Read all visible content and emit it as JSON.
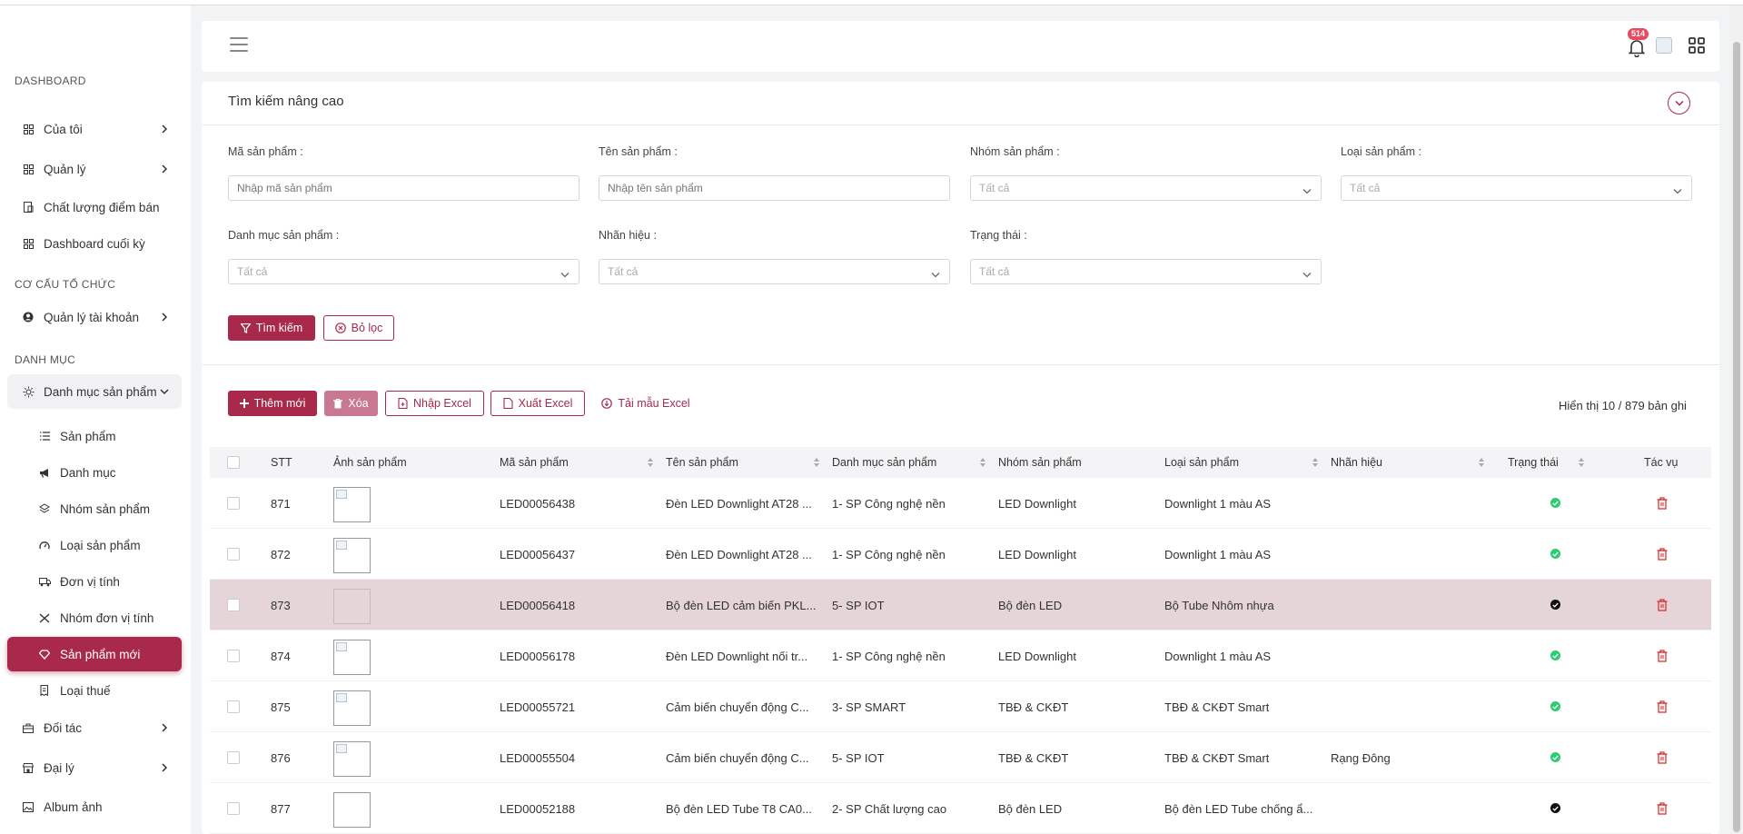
{
  "sidebar": {
    "sections": [
      "DASHBOARD",
      "CƠ CẤU TỔ CHỨC",
      "DANH MỤC"
    ],
    "items": [
      {
        "label": "Của tôi",
        "icon": "dashboard-grid-icon"
      },
      {
        "label": "Quản lý",
        "icon": "dashboard-grid-icon"
      },
      {
        "label": "Chất lượng điểm bán",
        "icon": "store-icon"
      },
      {
        "label": "Dashboard cuối kỳ",
        "icon": "dashboard-grid-icon"
      },
      {
        "label": "Quản lý tài khoản",
        "icon": "user-circle-icon"
      },
      {
        "label": "Danh mục sản phẩm",
        "icon": "sun-icon"
      },
      {
        "label": "Sản phẩm",
        "icon": "list-icon"
      },
      {
        "label": "Danh mục",
        "icon": "megaphone-icon"
      },
      {
        "label": "Nhóm sản phẩm",
        "icon": "layers-icon"
      },
      {
        "label": "Loại sản phẩm",
        "icon": "gauge-icon"
      },
      {
        "label": "Đơn vị tính",
        "icon": "truck-icon"
      },
      {
        "label": "Nhóm đơn vị tính",
        "icon": "shuffle-icon"
      },
      {
        "label": "Sản phẩm mới",
        "icon": "diamond-icon"
      },
      {
        "label": "Loại thuế",
        "icon": "receipt-icon"
      },
      {
        "label": "Đối tác",
        "icon": "briefcase-icon"
      },
      {
        "label": "Đại lý",
        "icon": "shop-icon"
      },
      {
        "label": "Album ảnh",
        "icon": "image-icon"
      }
    ]
  },
  "header": {
    "notification_count": "514"
  },
  "search": {
    "title": "Tìm kiếm nâng cao",
    "fields": {
      "product_code": {
        "label": "Mã sản phẩm :",
        "placeholder": "Nhập mã sản phẩm"
      },
      "product_name": {
        "label": "Tên sản phẩm :",
        "placeholder": "Nhập tên sản phẩm"
      },
      "product_group": {
        "label": "Nhóm sản phẩm :",
        "value": "Tất cả"
      },
      "product_type": {
        "label": "Loại sản phẩm :",
        "value": "Tất cả"
      },
      "product_category": {
        "label": "Danh mục sản phẩm :",
        "value": "Tất cả"
      },
      "brand": {
        "label": "Nhãn hiệu :",
        "value": "Tất cả"
      },
      "status": {
        "label": "Trạng thái :",
        "value": "Tất cả"
      }
    },
    "search_button": "Tìm kiếm",
    "reset_button": "Bỏ lọc"
  },
  "toolbar": {
    "add": "Thêm mới",
    "delete": "Xóa",
    "import": "Nhập Excel",
    "export": "Xuất Excel",
    "template": "Tải mẫu Excel",
    "record_info": "Hiển thị 10 / 879 bản ghi"
  },
  "table": {
    "columns": [
      "STT",
      "Ảnh sản phẩm",
      "Mã sản phẩm",
      "Tên sản phẩm",
      "Danh mục sản phẩm",
      "Nhóm sản phẩm",
      "Loại sản phẩm",
      "Nhãn hiệu",
      "Trạng thái",
      "Tác vụ"
    ],
    "rows": [
      {
        "stt": "871",
        "code": "LED00056438",
        "name": "Đèn LED Downlight AT28 ...",
        "category": "1- SP Công nghệ nền",
        "group": "LED Downlight",
        "type": "Downlight 1 màu AS",
        "brand": "",
        "status": "active"
      },
      {
        "stt": "872",
        "code": "LED00056437",
        "name": "Đèn LED Downlight AT28 ...",
        "category": "1- SP Công nghệ nền",
        "group": "LED Downlight",
        "type": "Downlight 1 màu AS",
        "brand": "",
        "status": "active"
      },
      {
        "stt": "873",
        "code": "LED00056418",
        "name": "Bộ đèn LED cảm biến PKL...",
        "category": "5- SP IOT",
        "group": "Bộ đèn LED",
        "type": "Bộ Tube Nhôm nhựa",
        "brand": "",
        "status": "dark"
      },
      {
        "stt": "874",
        "code": "LED00056178",
        "name": "Đèn LED Downlight nối tr...",
        "category": "1- SP Công nghệ nền",
        "group": "LED Downlight",
        "type": "Downlight 1 màu AS",
        "brand": "",
        "status": "active"
      },
      {
        "stt": "875",
        "code": "LED00055721",
        "name": "Cảm biến chuyển động C...",
        "category": "3- SP SMART",
        "group": "TBĐ & CKĐT",
        "type": "TBĐ & CKĐT Smart",
        "brand": "",
        "status": "active"
      },
      {
        "stt": "876",
        "code": "LED00055504",
        "name": "Cảm biến chuyển động C...",
        "category": "5- SP IOT",
        "group": "TBĐ & CKĐT",
        "type": "TBĐ & CKĐT Smart",
        "brand": "Rạng Đông",
        "status": "active"
      },
      {
        "stt": "877",
        "code": "LED00052188",
        "name": "Bộ đèn LED Tube T8 CA0...",
        "category": "2- SP Chất lượng cao",
        "group": "Bộ đèn LED",
        "type": "Bộ đèn LED Tube chống ẩ...",
        "brand": "",
        "status": "dark"
      }
    ]
  },
  "colors": {
    "accent": "#a8294a",
    "active_status": "#2ecc71",
    "dark_status": "#111111",
    "highlight_row": "#e5d5d8"
  }
}
